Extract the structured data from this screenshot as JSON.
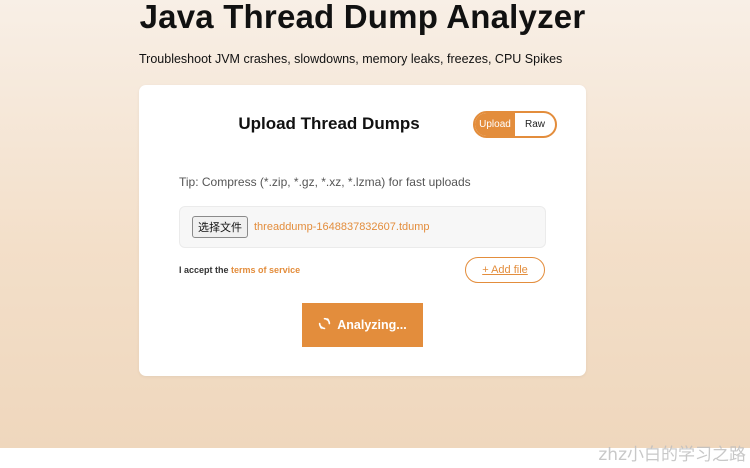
{
  "page": {
    "title": "Java Thread Dump Analyzer",
    "subtitle": "Troubleshoot JVM crashes, slowdowns, memory leaks, freezes, CPU Spikes"
  },
  "card": {
    "title": "Upload Thread Dumps",
    "toggle": {
      "options": [
        "Upload",
        "Raw"
      ],
      "selected": "Upload"
    },
    "tip": "Tip: Compress (*.zip, *.gz, *.xz, *.lzma) for fast uploads",
    "file_input": {
      "button_label": "选择文件",
      "file_name": "threaddump-1648837832607.tdump"
    },
    "terms": {
      "prefix": "I accept the",
      "link": "terms of service"
    },
    "add_file_label": "+ Add file",
    "analyze_label": "Analyzing...",
    "analyze_icon": "spinner-icon"
  },
  "watermark": "zhz小白的学习之路",
  "colors": {
    "accent": "#e38d3c",
    "background_top": "#f8efe6",
    "background_bottom": "#efd7bd"
  }
}
